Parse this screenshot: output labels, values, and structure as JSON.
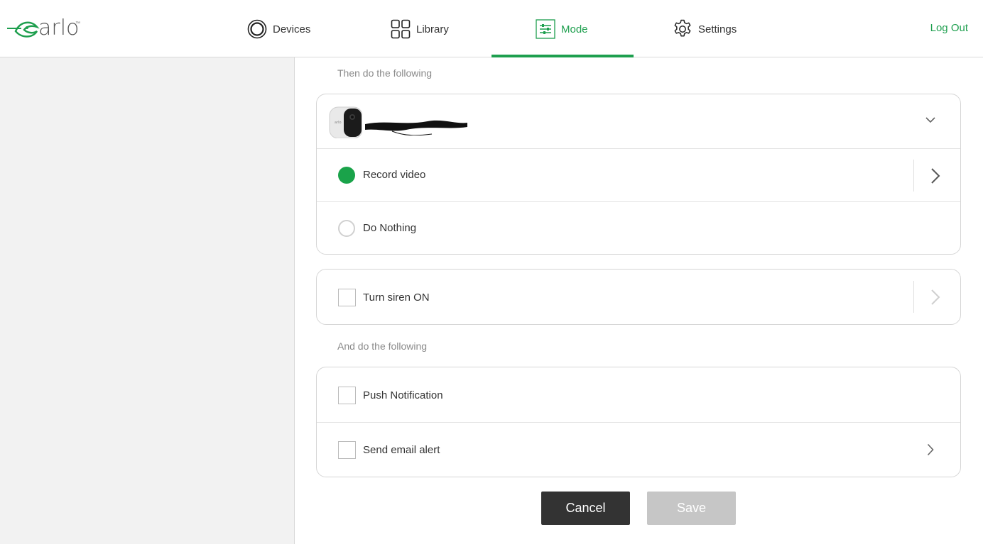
{
  "brand": {
    "logo_text": "arlo",
    "tm": "™",
    "accent_color": "#1e9f4e"
  },
  "nav": {
    "items": [
      {
        "label": "Devices",
        "icon": "devices-icon"
      },
      {
        "label": "Library",
        "icon": "library-icon"
      },
      {
        "label": "Mode",
        "icon": "mode-icon",
        "active": true
      },
      {
        "label": "Settings",
        "icon": "gear-icon"
      }
    ],
    "logout_label": "Log Out"
  },
  "main": {
    "then_label": "Then do the following",
    "camera_card": {
      "camera_name": "[redacted]",
      "options": [
        {
          "label": "Record video",
          "selected": true
        },
        {
          "label": "Do Nothing",
          "selected": false
        }
      ]
    },
    "siren": {
      "label": "Turn siren ON",
      "checked": false
    },
    "and_label": "And do the following",
    "alerts": [
      {
        "label": "Push Notification",
        "checked": false
      },
      {
        "label": "Send email alert",
        "checked": false
      }
    ]
  },
  "actions": {
    "cancel_label": "Cancel",
    "save_label": "Save"
  }
}
